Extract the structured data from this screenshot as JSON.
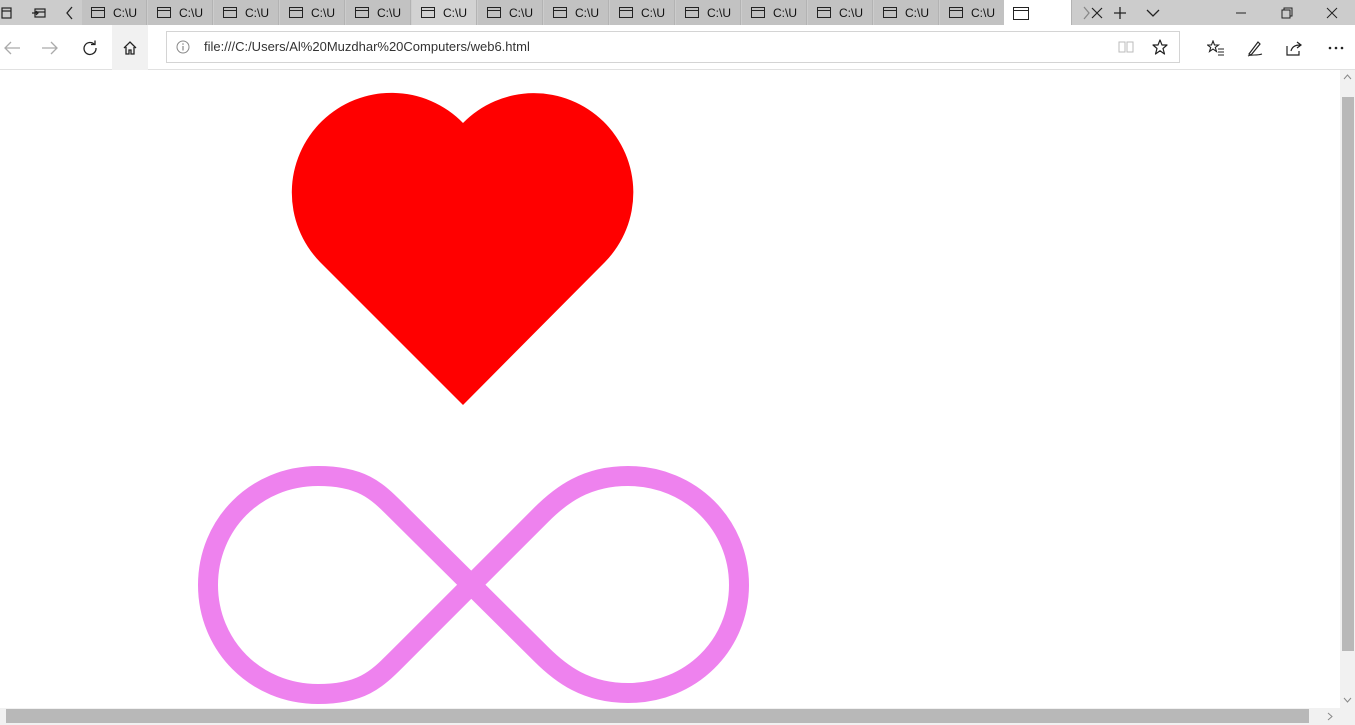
{
  "tabs": [
    {
      "label": "C:\\U"
    },
    {
      "label": "C:\\U"
    },
    {
      "label": "C:\\U"
    },
    {
      "label": "C:\\U"
    },
    {
      "label": "C:\\U"
    },
    {
      "label": "C:\\U"
    },
    {
      "label": "C:\\U"
    },
    {
      "label": "C:\\U"
    },
    {
      "label": "C:\\U"
    },
    {
      "label": "C:\\U"
    },
    {
      "label": "C:\\U"
    },
    {
      "label": "C:\\U"
    },
    {
      "label": "C:\\U"
    },
    {
      "label": "C:\\U"
    }
  ],
  "address": {
    "url": "file:///C:/Users/Al%20Muzdhar%20Computers/web6.html"
  },
  "shapes": {
    "heart_color": "#ff0000",
    "infinity_color": "#ee82ee"
  },
  "icons": {
    "tab_menu": "tab-aside-icon",
    "set_aside": "set-aside-icon",
    "scroll_left": "chevron-left-icon",
    "scroll_right": "chevron-right-icon",
    "new_tab": "plus-icon",
    "tab_list": "chevron-down-icon",
    "minimize": "minimize-icon",
    "restore": "restore-icon",
    "close": "close-icon",
    "back": "back-arrow-icon",
    "forward": "forward-arrow-icon",
    "refresh": "refresh-icon",
    "home": "home-icon",
    "info": "info-icon",
    "reading_view": "reading-view-icon",
    "favorite": "star-icon",
    "favorites_hub": "favorites-icon",
    "notes": "pen-icon",
    "share": "share-icon",
    "more": "more-icon"
  }
}
